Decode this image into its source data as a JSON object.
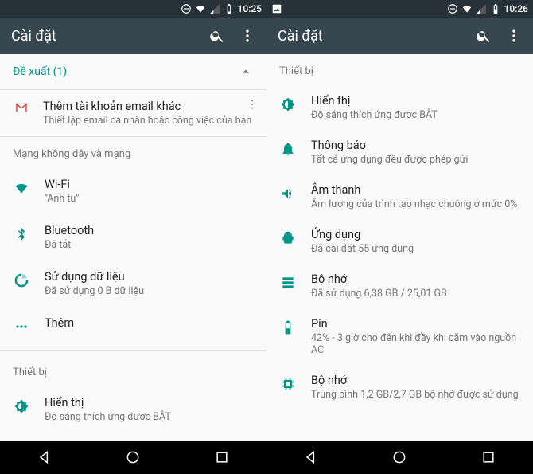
{
  "colors": {
    "accent": "#009688",
    "topbar": "#37474f",
    "statusbar": "#263238",
    "text": "#212121",
    "subtext": "#757575"
  },
  "left": {
    "status_time": "10:25",
    "topbar_title": "Cài đặt",
    "suggestions_label": "Đề xuất (1)",
    "gmail": {
      "title": "Thêm tài khoản email khác",
      "sub": "Thiết lập email cá nhân hoặc công việc của bạn"
    },
    "section_wireless": "Mạng không dây và mạng",
    "wifi": {
      "title": "Wi-Fi",
      "sub": "\"Anh tu\""
    },
    "bluetooth": {
      "title": "Bluetooth",
      "sub": "Đã tắt"
    },
    "data": {
      "title": "Sử dụng dữ liệu",
      "sub": "Đã sử dụng 0 B dữ liệu"
    },
    "more": {
      "title": "Thêm"
    },
    "section_device": "Thiết bị",
    "display": {
      "title": "Hiển thị",
      "sub": "Độ sáng thích ứng được BẬT"
    }
  },
  "right": {
    "status_time": "10:26",
    "topbar_title": "Cài đặt",
    "section_device": "Thiết bị",
    "display": {
      "title": "Hiển thị",
      "sub": "Độ sáng thích ứng được BẬT"
    },
    "notifications": {
      "title": "Thông báo",
      "sub": "Tất cả ứng dụng đều được phép gửi"
    },
    "sound": {
      "title": "Âm thanh",
      "sub": "Âm lượng của trình tạo nhạc chuông ở mức 0%"
    },
    "apps": {
      "title": "Ứng dụng",
      "sub": "Đã cài đặt 55 ứng dụng"
    },
    "storage": {
      "title": "Bộ nhớ",
      "sub": "Đã sử dụng 6,38 GB / 25,01 GB"
    },
    "battery": {
      "title": "Pin",
      "sub": "42% - 3 giờ cho đến khi đầy khi cắm vào nguồn AC"
    },
    "memory": {
      "title": "Bộ nhớ",
      "sub": "Trung bình 1,2 GB/2,7 GB bộ nhớ được sử dụng"
    }
  }
}
